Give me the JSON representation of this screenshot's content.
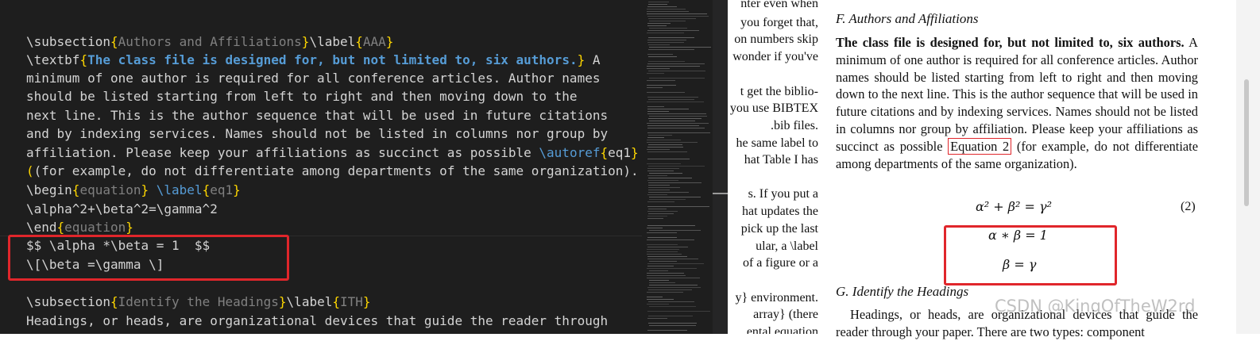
{
  "editor": {
    "lines": [
      {
        "pre": "",
        "cmd": "\\subsection",
        "arg1": "Authors and Affiliations",
        "cmd2": "\\label",
        "arg2": "AAA",
        "post": ""
      },
      {
        "pre": "",
        "cmd": "\\textbf",
        "arg1": "The class file is designed for, but not limited to, six authors.",
        "post": " A"
      },
      {
        "text": "minimum of one author is required for all conference articles. Author names"
      },
      {
        "text": "should be listed starting from left to right and then moving down to the"
      },
      {
        "text": "next line. This is the author sequence that will be used in future citations"
      },
      {
        "text": "and by indexing services. Names should not be listed in columns nor group by"
      },
      {
        "pre": "affiliation. Please keep your affiliations as succinct as possible ",
        "cmd": "\\autoref",
        "arg1": "eq1",
        "post": ""
      },
      {
        "text": "(for example, do not differentiate among departments of the same organization)."
      },
      {
        "cmd": "\\begin",
        "arg1": "equation",
        "cmd2": " \\label",
        "arg2": "eq1"
      },
      {
        "text": "\\alpha^2+\\beta^2=\\gamma^2"
      },
      {
        "cmd": "\\end",
        "arg1": "equation"
      },
      {
        "text": "$$ \\alpha *\\beta = 1  $$"
      },
      {
        "text": "\\[\\beta =\\gamma \\]"
      },
      {
        "text": ""
      },
      {
        "cmd": "\\subsection",
        "arg1": "Identify the Headings",
        "cmd2": "\\label",
        "arg2": "ITH"
      },
      {
        "text": "Headings, or heads, are organizational devices that guide the reader through"
      }
    ]
  },
  "pdf_left_fragments": [
    "nter even when",
    "you forget that,",
    "on numbers skip",
    "wonder if you've",
    "",
    "t get the biblio-",
    "you use BIBTEX",
    ".bib files.",
    "he same label to",
    "hat Table I has",
    "",
    "s. If you put a",
    "hat updates the",
    "pick up the last",
    "ular, a \\label",
    "of a figure or a",
    "",
    "y} environment.",
    "array} (there",
    "ental equation"
  ],
  "pdf": {
    "section_f": "F. Authors and Affiliations",
    "bold_lead": "The class file is designed for, but not limited to, six authors.",
    "para_f_a": " A minimum of one author is required for all conference articles. Author names should be listed starting from left to right and then moving down to the next line. This is the author sequence that will be used in future citations and by indexing services. Names should not be listed in columns nor group by affiliation. Please keep your affiliations as succinct as possible ",
    "eq_ref": "Equation 2",
    "para_f_b": " (for example, do not differentiate among departments of the same organization).",
    "eq_main": "α² + β² = γ²",
    "eq_number": "(2)",
    "eq_a": "α ∗ β = 1",
    "eq_b": "β = γ",
    "section_g": "G. Identify the Headings",
    "para_g": "Headings, or heads, are organizational devices that guide the reader through your paper. There are two types: component"
  },
  "watermark": "CSDN @KingOfTheW2rd",
  "colors": {
    "highlight": "#e0262b",
    "editor_bg": "#1e1e1e",
    "brace": "#ffd700",
    "bold_arg": "#569cd6",
    "muted_arg": "#808080"
  }
}
